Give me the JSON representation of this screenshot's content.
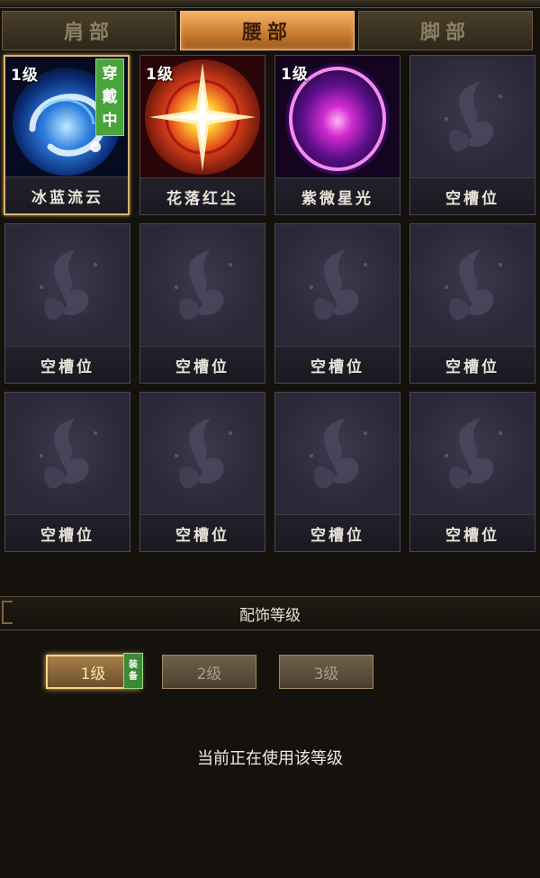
{
  "tabs": [
    {
      "label": "肩部",
      "active": false
    },
    {
      "label": "腰部",
      "active": true
    },
    {
      "label": "脚部",
      "active": false
    }
  ],
  "slots": [
    {
      "name": "冰蓝流云",
      "level": "1级",
      "worn": "穿戴中",
      "icon": "blue-swirl-orb-icon"
    },
    {
      "name": "花落红尘",
      "level": "1级",
      "icon": "red-starburst-icon"
    },
    {
      "name": "紫微星光",
      "level": "1级",
      "icon": "purple-ring-icon"
    },
    {
      "name": "空槽位",
      "icon": "butterfly-placeholder-icon"
    },
    {
      "name": "空槽位",
      "icon": "butterfly-placeholder-icon"
    },
    {
      "name": "空槽位",
      "icon": "butterfly-placeholder-icon"
    },
    {
      "name": "空槽位",
      "icon": "butterfly-placeholder-icon"
    },
    {
      "name": "空槽位",
      "icon": "butterfly-placeholder-icon"
    },
    {
      "name": "空槽位",
      "icon": "butterfly-placeholder-icon"
    },
    {
      "name": "空槽位",
      "icon": "butterfly-placeholder-icon"
    },
    {
      "name": "空槽位",
      "icon": "butterfly-placeholder-icon"
    },
    {
      "name": "空槽位",
      "icon": "butterfly-placeholder-icon"
    }
  ],
  "section_title": "配饰等级",
  "level_buttons": [
    {
      "label": "1级",
      "active": true
    },
    {
      "label": "2级",
      "active": false
    },
    {
      "label": "3级",
      "active": false
    }
  ],
  "equip_badge": "装备",
  "status_text": "当前正在使用该等级",
  "colors": {
    "accent": "#d8b46a",
    "worn_green": "#49a53b",
    "tab_active": "#c77a2c"
  }
}
